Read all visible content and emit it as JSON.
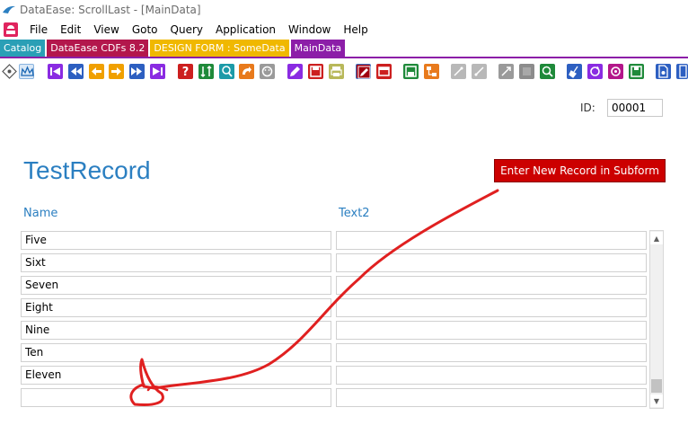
{
  "window": {
    "title": "DataEase: ScrollLast - [MainData]"
  },
  "menu": {
    "items": [
      "File",
      "Edit",
      "View",
      "Goto",
      "Query",
      "Application",
      "Window",
      "Help"
    ]
  },
  "tabs": [
    {
      "label": "Catalog",
      "color": "#2a9fb6"
    },
    {
      "label": "DataEase CDFs 8.2",
      "color": "#b3174c"
    },
    {
      "label": "DESIGN FORM : SomeData",
      "color": "#f0b800"
    },
    {
      "label": "MainData",
      "color": "#8c1ea8"
    }
  ],
  "toolbar": {
    "icons": [
      "navigate-diamond-icon",
      "crown-icon",
      "first-record-icon",
      "previous-record-icon",
      "back-icon",
      "forward-icon",
      "next-record-icon",
      "last-record-icon",
      "help-icon",
      "sort-icon",
      "find-icon",
      "redo-icon",
      "clear-icon",
      "edit-record-icon",
      "save-icon",
      "print-icon",
      "design-pencil-icon",
      "layout-icon",
      "save-green-icon",
      "structure-icon",
      "relation-icon",
      "link-icon",
      "expand-icon",
      "block-icon",
      "zoom-green-icon",
      "broom-icon",
      "refresh-icon",
      "cycle-icon",
      "disk-green-icon",
      "document-icon",
      "document-copy-icon"
    ]
  },
  "form": {
    "id_label": "ID:",
    "id_value": "00001",
    "title": "TestRecord",
    "new_record_button": "Enter New Record in Subform",
    "column_name": "Name",
    "column_text2": "Text2",
    "rows": [
      {
        "name": "Five",
        "text2": ""
      },
      {
        "name": "Sixt",
        "text2": ""
      },
      {
        "name": "Seven",
        "text2": ""
      },
      {
        "name": "Eight",
        "text2": ""
      },
      {
        "name": "Nine",
        "text2": ""
      },
      {
        "name": "Ten",
        "text2": ""
      },
      {
        "name": "Eleven",
        "text2": ""
      },
      {
        "name": "",
        "text2": ""
      }
    ]
  },
  "colors": {
    "accent": "#2b7fc1",
    "button_red": "#cc0000",
    "annotation_red": "#e02020"
  }
}
